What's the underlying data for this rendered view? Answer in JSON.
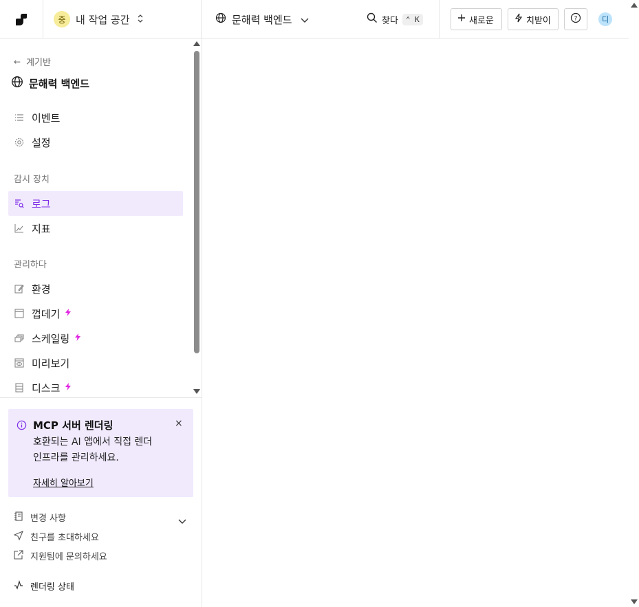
{
  "workspace": {
    "avatar": "중",
    "name": "내 작업 공간"
  },
  "project": {
    "name": "문해력 백엔드"
  },
  "search": {
    "label": "찾다",
    "shortcut": "⌃ K"
  },
  "actions": {
    "new_label": "새로운",
    "upgrade_label": "치받이",
    "help_label": "?"
  },
  "user": {
    "avatar": "디",
    "avatar_color": "#bde3fb"
  },
  "sidebar": {
    "back_label": "계기반",
    "service_title": "문해력 백엔드",
    "items_top": [
      {
        "label": "이벤트",
        "icon": "list-icon"
      },
      {
        "label": "설정",
        "icon": "gear-icon"
      }
    ],
    "section_monitor": "감시 장치",
    "items_monitor": [
      {
        "label": "로그",
        "icon": "logs-search-icon",
        "active": true
      },
      {
        "label": "지표",
        "icon": "line-chart-icon"
      }
    ],
    "section_manage": "관리하다",
    "items_manage": [
      {
        "label": "환경",
        "icon": "edit-icon"
      },
      {
        "label": "껍데기",
        "icon": "terminal-icon",
        "premium": true
      },
      {
        "label": "스케일링",
        "icon": "layers-icon",
        "premium": true
      },
      {
        "label": "미리보기",
        "icon": "preview-icon"
      },
      {
        "label": "디스크",
        "icon": "disk-icon",
        "premium": true
      }
    ],
    "accent_color": "#7e2ee6",
    "active_bg": "#f1eafd",
    "premium_color": "#e024e0"
  },
  "notice": {
    "title": "MCP 서버 렌더링",
    "body": "호환되는 AI 앱에서 직접 렌더 인프라를 관리하세요.",
    "link": "자세히 알아보기",
    "close": "×"
  },
  "footer": {
    "changelog": "변경 사항",
    "invite": "친구를 초대하세요",
    "support": "지원팀에 문의하세요",
    "status": "렌더링 상태"
  }
}
